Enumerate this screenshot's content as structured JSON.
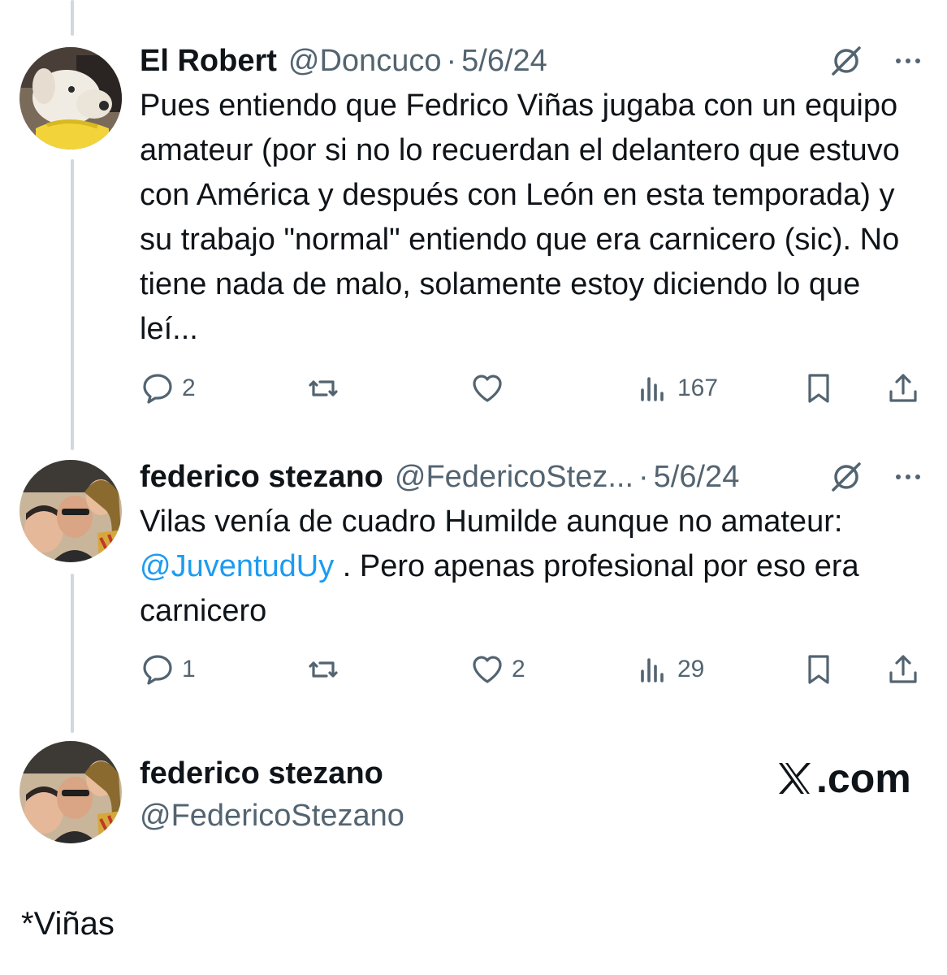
{
  "tweet1": {
    "name": "El Robert",
    "handle": "@Doncuco",
    "separator": "·",
    "date": "5/6/24",
    "text": "Pues entiendo que Fedrico Viñas jugaba con un equipo amateur (por si no lo recuerdan el delantero que estuvo con América y después con León en esta temporada) y su trabajo \"normal\" entiendo que era carnicero (sic). No tiene nada de malo, solamente estoy diciendo lo que leí...",
    "replies": "2",
    "reposts": "",
    "likes": "",
    "views": "167"
  },
  "tweet2": {
    "name": "federico stezano",
    "handle": "@FedericoStez...",
    "separator": "·",
    "date": "5/6/24",
    "text_before": "Vilas venía de cuadro Humilde aunque no amateur: ",
    "mention": "@JuventudUy",
    "text_after": " . Pero apenas profesional por eso era carnicero",
    "replies": "1",
    "reposts": "",
    "likes": "2",
    "views": "29"
  },
  "profile_card": {
    "name": "federico stezano",
    "handle": "@FedericoStezano",
    "site": ".com"
  },
  "footnote": "*Viñas",
  "icons": {
    "reply": "reply-icon",
    "repost": "repost-icon",
    "like": "heart-icon",
    "views": "views-icon",
    "bookmark": "bookmark-icon",
    "share": "share-icon",
    "grok": "grok-icon",
    "more": "more-icon",
    "x_logo": "x-logo-icon"
  },
  "colors": {
    "text": "#0f1419",
    "secondary": "#536471",
    "link": "#1d9bf0",
    "thread_line": "#cfd9de"
  }
}
